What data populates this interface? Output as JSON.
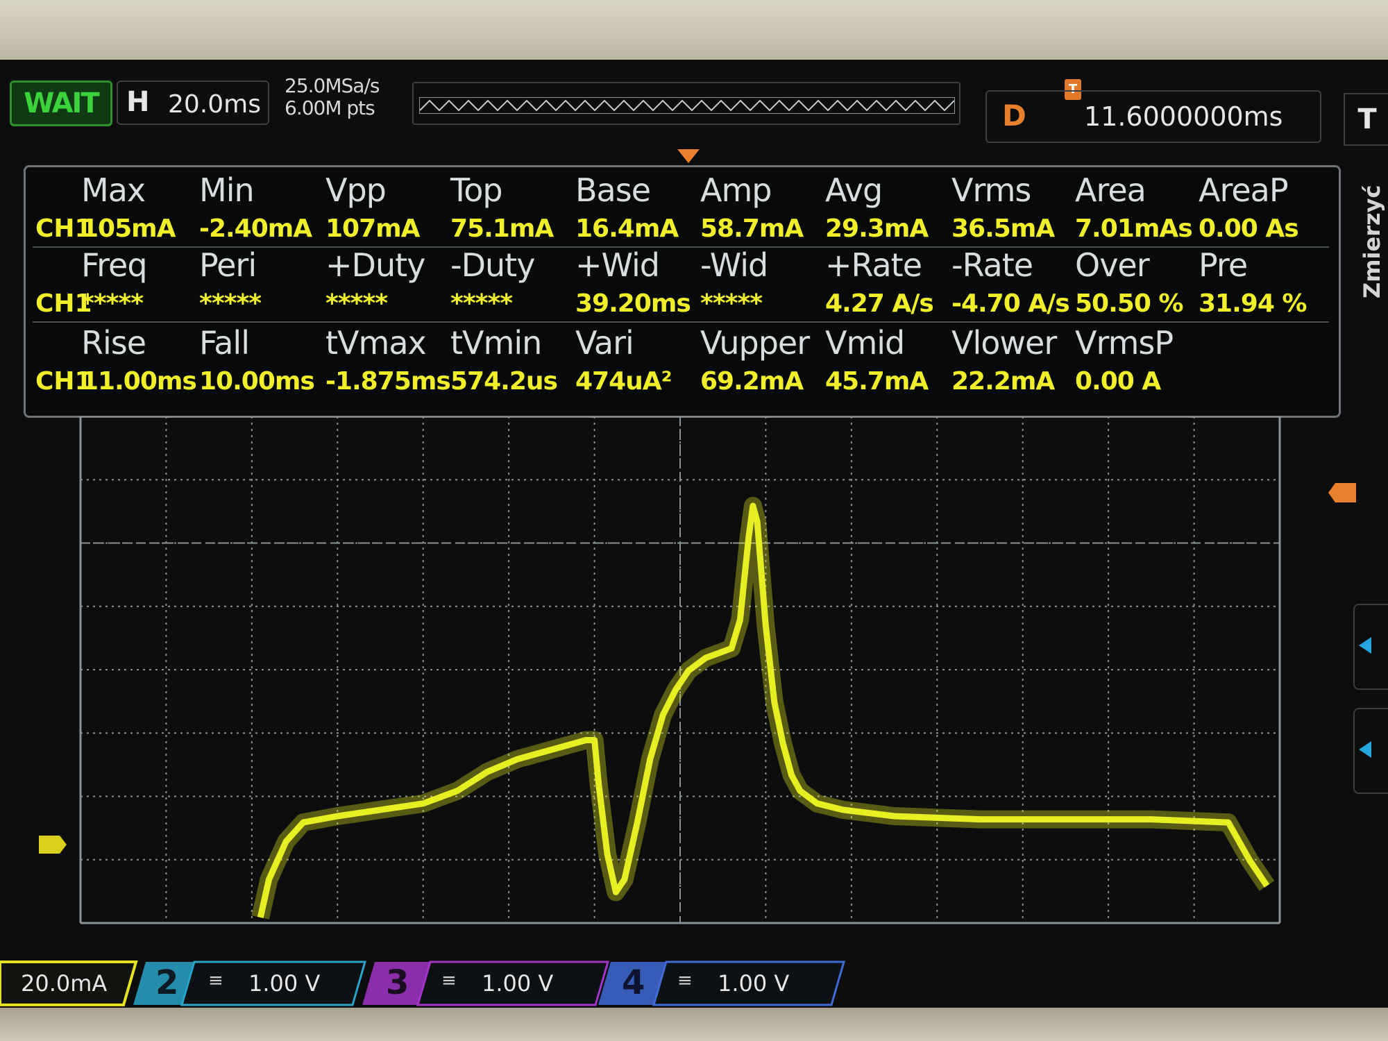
{
  "status": {
    "run_state": "WAIT",
    "timebase_key": "H",
    "timebase": "20.0ms",
    "sample_rate": "25.0MSa/s",
    "memory_depth": "6.00M pts",
    "trigger_marker": "T",
    "delay_key": "D",
    "delay": "11.6000000ms",
    "trigger_key": "T",
    "side_label": "Zmierzyć"
  },
  "measurements": {
    "rows": [
      {
        "channel": "CH1",
        "headers": [
          "Max",
          "Min",
          "Vpp",
          "Top",
          "Base",
          "Amp",
          "Avg",
          "Vrms",
          "Area",
          "AreaP"
        ],
        "values": [
          "105mA",
          "-2.40mA",
          "107mA",
          "75.1mA",
          "16.4mA",
          "58.7mA",
          "29.3mA",
          "36.5mA",
          "7.01mAs",
          "0.00 As"
        ]
      },
      {
        "channel": "CH1",
        "headers": [
          "Freq",
          "Peri",
          "+Duty",
          "-Duty",
          "+Wid",
          "-Wid",
          "+Rate",
          "-Rate",
          "Over",
          "Pre"
        ],
        "values": [
          "*****",
          "*****",
          "*****",
          "*****",
          "39.20ms",
          "*****",
          "4.27 A/s",
          "-4.70 A/s",
          "50.50 %",
          "31.94 %"
        ]
      },
      {
        "channel": "CH1",
        "headers": [
          "Rise",
          "Fall",
          "tVmax",
          "tVmin",
          "Vari",
          "Vupper",
          "Vmid",
          "Vlower",
          "VrmsP"
        ],
        "values": [
          "11.00ms",
          "10.00ms",
          "-1.875ms",
          "574.2us",
          "474uA²",
          "69.2mA",
          "45.7mA",
          "22.2mA",
          "0.00 A"
        ]
      }
    ]
  },
  "trace": {
    "color": "#e6ef22",
    "unit": "mA",
    "points": [
      [
        -98,
        0
      ],
      [
        -96,
        12
      ],
      [
        -92,
        24
      ],
      [
        -88,
        30
      ],
      [
        -80,
        32
      ],
      [
        -70,
        34
      ],
      [
        -60,
        36
      ],
      [
        -52,
        40
      ],
      [
        -45,
        46
      ],
      [
        -38,
        50
      ],
      [
        -30,
        53
      ],
      [
        -22,
        56
      ],
      [
        -20,
        56
      ],
      [
        -19,
        42
      ],
      [
        -17,
        20
      ],
      [
        -15,
        8
      ],
      [
        -13,
        12
      ],
      [
        -10,
        30
      ],
      [
        -7,
        50
      ],
      [
        -4,
        64
      ],
      [
        -1,
        72
      ],
      [
        2,
        78
      ],
      [
        6,
        82
      ],
      [
        10,
        84
      ],
      [
        12,
        85
      ],
      [
        14,
        94
      ],
      [
        16,
        120
      ],
      [
        17,
        130
      ],
      [
        18,
        125
      ],
      [
        20,
        92
      ],
      [
        22,
        68
      ],
      [
        24,
        55
      ],
      [
        26,
        45
      ],
      [
        28,
        40
      ],
      [
        32,
        36
      ],
      [
        38,
        34
      ],
      [
        50,
        32
      ],
      [
        70,
        31
      ],
      [
        90,
        31
      ],
      [
        110,
        31
      ],
      [
        128,
        30
      ],
      [
        133,
        18
      ],
      [
        137,
        10
      ]
    ],
    "color_grid": "#8a9298"
  },
  "channels": [
    {
      "number": "1",
      "coupling": "",
      "scale": "20.0mA",
      "color": "#e8e21e"
    },
    {
      "number": "2",
      "coupling": "≡",
      "scale": "1.00 V",
      "color": "#2aa3c9"
    },
    {
      "number": "3",
      "coupling": "≡",
      "scale": "1.00 V",
      "color": "#a235c8"
    },
    {
      "number": "4",
      "coupling": "≡",
      "scale": "1.00 V",
      "color": "#3f6bd6"
    }
  ]
}
